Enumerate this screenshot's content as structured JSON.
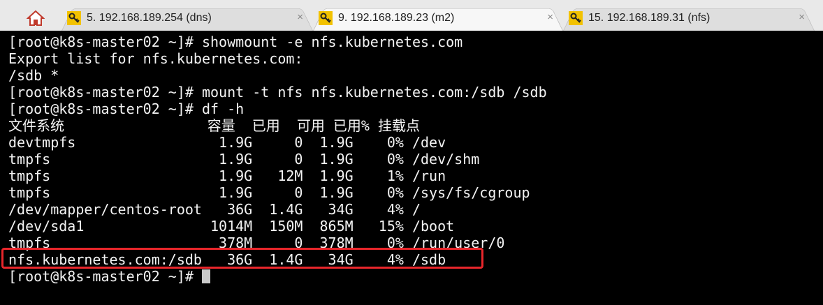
{
  "tabs": [
    {
      "label": "5. 192.168.189.254 (dns)",
      "close": "×",
      "active": false
    },
    {
      "label": "9. 192.168.189.23 (m2)",
      "close": "×",
      "active": true
    },
    {
      "label": "15. 192.168.189.31 (nfs)",
      "close": "×",
      "active": false
    }
  ],
  "terminal": {
    "lines": [
      "[root@k8s-master02 ~]# showmount -e nfs.kubernetes.com",
      "Export list for nfs.kubernetes.com:",
      "/sdb *",
      "[root@k8s-master02 ~]# mount -t nfs nfs.kubernetes.com:/sdb /sdb",
      "[root@k8s-master02 ~]# df -h",
      "文件系统                 容量  已用  可用 已用% 挂载点",
      "devtmpfs                 1.9G     0  1.9G    0% /dev",
      "tmpfs                    1.9G     0  1.9G    0% /dev/shm",
      "tmpfs                    1.9G   12M  1.9G    1% /run",
      "tmpfs                    1.9G     0  1.9G    0% /sys/fs/cgroup",
      "/dev/mapper/centos-root   36G  1.4G   34G    4% /",
      "/dev/sda1               1014M  150M  865M   15% /boot",
      "tmpfs                    378M     0  378M    0% /run/user/0",
      "nfs.kubernetes.com:/sdb   36G  1.4G   34G    4% /sdb"
    ],
    "prompt": "[root@k8s-master02 ~]# "
  },
  "colors": {
    "highlight": "#e8262b",
    "terminal_bg": "#000000",
    "terminal_fg": "#f3f3f3"
  }
}
